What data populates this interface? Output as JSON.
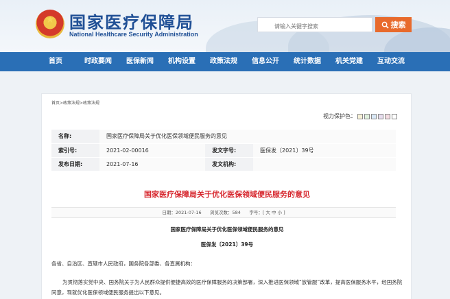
{
  "header": {
    "title": "国家医疗保障局",
    "subtitle": "National Healthcare Security Administration",
    "search_placeholder": "请输入关键字搜索",
    "search_label": "搜索"
  },
  "nav": {
    "items": [
      "首页",
      "时政要闻",
      "医保新闻",
      "机构设置",
      "政策法规",
      "信息公开",
      "统计数据",
      "机关党建",
      "互动交流"
    ]
  },
  "breadcrumb": "首页>政策法规>政策法规",
  "protect_label": "视力保护色：",
  "protect_colors": [
    "#f7f1d7",
    "#e0f0dd",
    "#d9e8f6",
    "#e7ddee",
    "#f5dde3",
    "#ffffff"
  ],
  "meta": {
    "name_label": "名称:",
    "name_value": "国家医疗保障局关于优化医保领域便民服务的意见",
    "index_label": "索引号:",
    "index_value": "2021-02-00016",
    "docno_label": "发文字号:",
    "docno_value": "医保发〔2021〕39号",
    "date_label": "发布日期:",
    "date_value": "2021-07-16",
    "org_label": "发文机构:",
    "org_value": ""
  },
  "doc_title": "国家医疗保障局关于优化医保领域便民服务的意见",
  "info": {
    "date": "日期：2021-07-16",
    "views": "浏览次数：584",
    "font": "字号：[ 大 中 小 ]"
  },
  "body": {
    "title": "国家医疗保障局关于优化医保领域便民服务的意见",
    "number": "医保发〔2021〕39号",
    "p1": "各省、自治区、直辖市人民政府，国务院各部委、各直属机构：",
    "p2": "为贯彻落实党中央、国务院关于为人民群众提供便捷高效的医疗保障服务的决策部署，深入推进医保领域“放管服”改革，提高医保服务水平，经国务院同意，现就优化医保领域便民服务提出以下意见。"
  }
}
